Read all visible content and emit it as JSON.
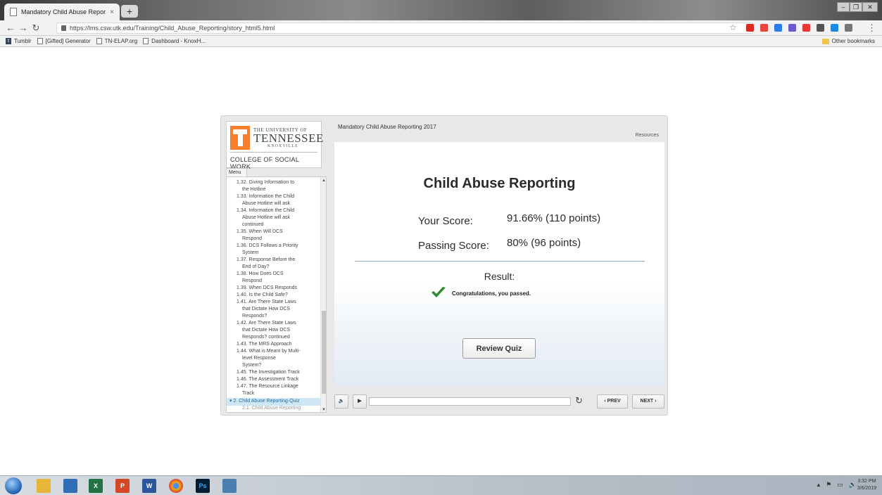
{
  "browser": {
    "tab_title": "Mandatory Child Abuse Reportin",
    "tab_close": "×",
    "new_tab": "+",
    "url": "https://lms.csw.utk.edu/Training/Child_Abuse_Reporting/story_html5.html",
    "bookmarks": [
      "Tumblr",
      "[Gifted] Generator",
      "TN-ELAP.org",
      "Dashboard - KnoxH..."
    ],
    "other_bookmarks": "Other bookmarks",
    "win_minimize": "–",
    "win_restore": "❐",
    "win_close": "✕"
  },
  "logo": {
    "university_of": "THE UNIVERSITY OF",
    "tennessee": "TENNESSEE",
    "knoxville": "KNOXVILLE",
    "college": "COLLEGE OF SOCIAL WORK"
  },
  "menu": {
    "tab_label": "Menu",
    "items": [
      {
        "text": "report",
        "type": "cont"
      },
      {
        "text": "1.32. Giving Information to",
        "type": "item"
      },
      {
        "text": "the Hotline",
        "type": "cont"
      },
      {
        "text": "1.33. Information the Child",
        "type": "item"
      },
      {
        "text": "Abuse Hotline will ask",
        "type": "cont"
      },
      {
        "text": "1.34. Information the Child",
        "type": "item"
      },
      {
        "text": "Abuse Hotline will ask",
        "type": "cont"
      },
      {
        "text": "continued",
        "type": "cont"
      },
      {
        "text": "1.35. When Will DCS",
        "type": "item"
      },
      {
        "text": "Respond",
        "type": "cont"
      },
      {
        "text": "1.36. DCS Follows a Priority",
        "type": "item"
      },
      {
        "text": "System",
        "type": "cont"
      },
      {
        "text": "1.37. Response Before the",
        "type": "item"
      },
      {
        "text": "End of Day?",
        "type": "cont"
      },
      {
        "text": "1.38. How Does DCS",
        "type": "item"
      },
      {
        "text": "Respond",
        "type": "cont"
      },
      {
        "text": "1.39. When DCS Responds",
        "type": "item"
      },
      {
        "text": "1.40. Is the Child Safe?",
        "type": "item"
      },
      {
        "text": "1.41. Are There State Laws",
        "type": "item"
      },
      {
        "text": "that Dictate How DCS",
        "type": "cont"
      },
      {
        "text": "Responds?",
        "type": "cont"
      },
      {
        "text": "1.42. Are There State Laws",
        "type": "item"
      },
      {
        "text": "that Dictate How DCS",
        "type": "cont"
      },
      {
        "text": "Responds? continued",
        "type": "cont"
      },
      {
        "text": "1.43. The MRS Approach",
        "type": "item"
      },
      {
        "text": "1.44. What is Meant by Multi-",
        "type": "item"
      },
      {
        "text": "level Response",
        "type": "cont"
      },
      {
        "text": "System?",
        "type": "cont"
      },
      {
        "text": "1.45. The Investigation Track",
        "type": "item"
      },
      {
        "text": "1.46. The Assessment Track",
        "type": "item"
      },
      {
        "text": "1.47. The Resource Linkage",
        "type": "item"
      },
      {
        "text": "Track",
        "type": "cont"
      },
      {
        "text": "▾ 2. Child Abuse Reporting-Quiz",
        "type": "section"
      },
      {
        "text": "2.1. Child Abuse Reporting",
        "type": "sub"
      }
    ]
  },
  "player": {
    "course_title": "Mandatory Child Abuse Reporting 2017",
    "resources": "Resources"
  },
  "slide": {
    "heading": "Child Abuse Reporting",
    "your_score_label": "Your Score:",
    "your_score_value": "91.66% (110 points)",
    "passing_score_label": "Passing Score:",
    "passing_score_value": "80% (96 points)",
    "result_label": "Result:",
    "passed_message": "Congratulations, you passed.",
    "review_button": "Review Quiz"
  },
  "controls": {
    "volume_icon": "🔈",
    "play_icon": "▶",
    "replay_icon": "↻",
    "prev": "‹ PREV",
    "next": "NEXT ›",
    "progress": 0
  },
  "taskbar": {
    "time": "3:32 PM",
    "date": "3/6/2019"
  }
}
